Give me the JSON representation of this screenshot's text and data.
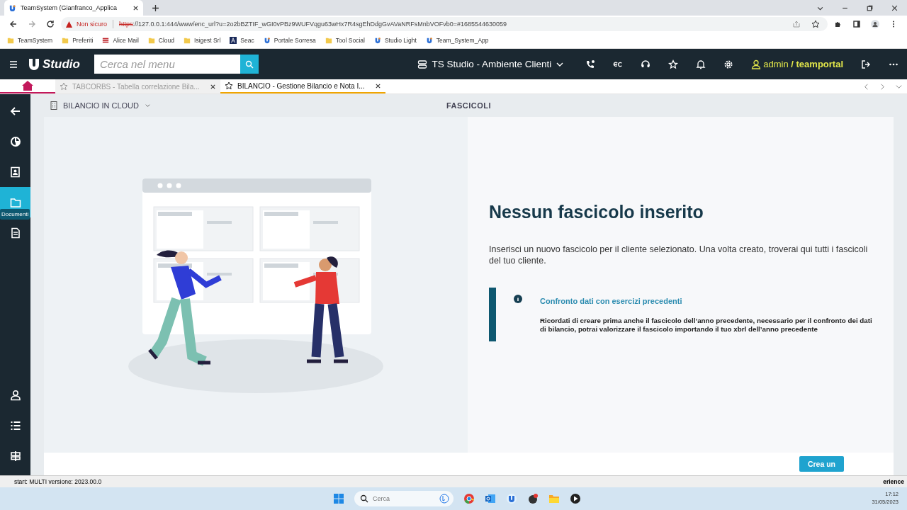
{
  "browser": {
    "tabs": [
      {
        "title": "TeamSystem (Gianfranco_Applica",
        "selected": true
      }
    ],
    "address": {
      "security": "Non sicuro",
      "scheme": "https",
      "url": "://127.0.0.1:444/www/enc_url?u=2o2bBZTIF_wGI0vPBz9WUFVqgu63wHx7R4sgEhDdgGvAVaNRFsMnbVOFvb0=#1685544630059"
    },
    "bookmarks": [
      {
        "label": "TeamSystem",
        "kind": "folder"
      },
      {
        "label": "Preferiti",
        "kind": "folder"
      },
      {
        "label": "Alice Mail",
        "kind": "mail"
      },
      {
        "label": "Cloud",
        "kind": "folder"
      },
      {
        "label": "Isigest Srl",
        "kind": "folder"
      },
      {
        "label": "Seac",
        "kind": "seac"
      },
      {
        "label": "Portale Sorresa",
        "kind": "app"
      },
      {
        "label": "Tool Social",
        "kind": "folder"
      },
      {
        "label": "Studio Light",
        "kind": "app"
      },
      {
        "label": "Team_System_App",
        "kind": "app"
      }
    ]
  },
  "app": {
    "logo": "Studio",
    "search": {
      "placeholder": "Cerca nel menu"
    },
    "environment": "TS Studio - Ambiente Clienti",
    "user": {
      "name": "admin",
      "org": "/ teamportal"
    }
  },
  "app_tabs": [
    {
      "label": "TABCORBS - Tabella correlazione Bila...",
      "selected": false
    },
    {
      "label": "BILANCIO - Gestione Bilancio e Nota I...",
      "selected": true
    }
  ],
  "sidebar": {
    "items": [
      {
        "kind": "back",
        "selected": false
      },
      {
        "kind": "chart",
        "selected": false
      },
      {
        "kind": "contacts",
        "selected": false
      },
      {
        "kind": "folder",
        "selected": true
      },
      {
        "kind": "document",
        "selected": false
      }
    ],
    "bottom_items": [
      {
        "kind": "user",
        "selected": false
      },
      {
        "kind": "list",
        "selected": false
      },
      {
        "kind": "signpost",
        "selected": false
      }
    ],
    "tooltip": "Documenti"
  },
  "breadcrumb": "BILANCIO IN CLOUD",
  "page_title": "FASCICOLI",
  "empty_state": {
    "title": "Nessun fascicolo inserito",
    "text": "Inserisci un nuovo fascicolo per il cliente selezionato. Una volta creato, troverai qui tutti i fascicoli del tuo cliente.",
    "info": {
      "title": "Confronto dati con esercizi precedenti",
      "text": "Ricordati di creare prima anche il fascicolo dell’anno precedente, necessario per il confronto dei dati di bilancio, potrai valorizzare il fascicolo importando il tuo xbrl dell’anno precedente"
    }
  },
  "create_button": "Crea un",
  "status_bar": {
    "left": "start: MULTI versione: 2023.00.0",
    "right": "erience"
  },
  "taskbar": {
    "search": {
      "placeholder": "Cerca"
    },
    "time": "17:12",
    "date": "31/05/2023"
  }
}
